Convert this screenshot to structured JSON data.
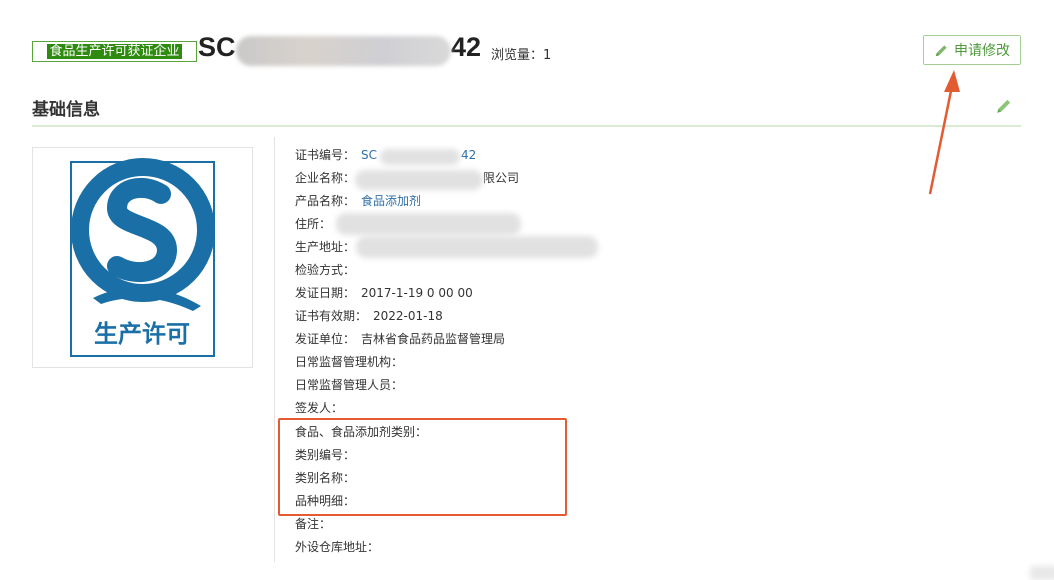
{
  "header": {
    "tag_label": "食品生产许可获证企业",
    "code_prefix": "SC",
    "code_suffix": "42",
    "views_label": "浏览量：",
    "views_count": "1",
    "edit_request_label": "申请修改"
  },
  "section": {
    "title": "基础信息"
  },
  "logo": {
    "caption": "生产许可",
    "colors": {
      "blue": "#1a6fa6",
      "text": "#1a6fa6"
    }
  },
  "fields": [
    {
      "label": "证书编号：",
      "value": "SC",
      "value_tail": "42",
      "link": true
    },
    {
      "label": "企业名称：",
      "value": "",
      "value_tail": "限公司",
      "link": false
    },
    {
      "label": "产品名称：",
      "value": "食品添加剂",
      "value_tail": "",
      "link": true
    },
    {
      "label": "住所：",
      "value": "",
      "value_tail": "",
      "link": false
    },
    {
      "label": "生产地址：",
      "value": "",
      "value_tail": "",
      "link": false
    },
    {
      "label": "检验方式：",
      "value": "",
      "value_tail": "",
      "link": false
    },
    {
      "label": "发证日期：",
      "value": "2017-1-19 0 00 00",
      "value_tail": "",
      "link": false
    },
    {
      "label": "证书有效期：",
      "value": "2022-01-18",
      "value_tail": "",
      "link": false
    },
    {
      "label": "发证单位：",
      "value": "吉林省食品药品监督管理局",
      "value_tail": "",
      "link": false
    },
    {
      "label": "日常监督管理机构：",
      "value": "",
      "value_tail": "",
      "link": false
    },
    {
      "label": "日常监督管理人员：",
      "value": "",
      "value_tail": "",
      "link": false
    },
    {
      "label": "签发人：",
      "value": "",
      "value_tail": "",
      "link": false
    },
    {
      "label": "食品、食品添加剂类别：",
      "value": "",
      "value_tail": "",
      "link": false
    },
    {
      "label": "类别编号：",
      "value": "",
      "value_tail": "",
      "link": false
    },
    {
      "label": "类别名称：",
      "value": "",
      "value_tail": "",
      "link": false
    },
    {
      "label": "品种明细：",
      "value": "",
      "value_tail": "",
      "link": false
    },
    {
      "label": "备注：",
      "value": "",
      "value_tail": "",
      "link": false
    },
    {
      "label": "外设仓库地址：",
      "value": "",
      "value_tail": "",
      "link": false
    }
  ],
  "colors": {
    "accent_green": "#4f9a3b",
    "annotation_red": "#e35b33",
    "link_blue": "#2f6fa7"
  }
}
